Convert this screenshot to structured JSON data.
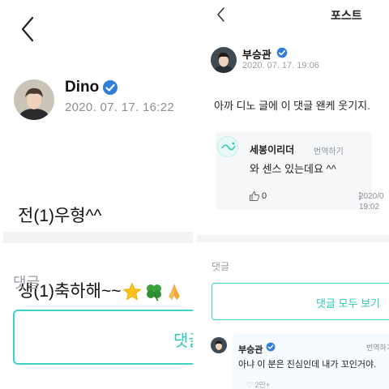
{
  "left": {
    "author": "Dino",
    "timestamp": "2020. 07. 17. 16:22",
    "body_line1": "전(1)우형^^",
    "body_line2": "생(1)축하해~~",
    "comments_header": "댓글",
    "comment_button_label": "댓글"
  },
  "right": {
    "header_title": "포스트",
    "author": "부승관",
    "timestamp": "2020. 07. 17. 19:06",
    "body": "아까 디노 글에 이 댓글 왠케 웃기지.",
    "quoted_comment": {
      "author": "세봉이리더",
      "translate_label": "번역하기",
      "text": "와 센스 있는데요 ^^",
      "like_count": "0",
      "time_line1": "2020/0",
      "time_line2": "19:02"
    },
    "comments_header": "댓글",
    "view_all_comments_label": "댓글 모두 보기",
    "reply": {
      "author": "부승관",
      "translate_label": "번역하기",
      "text": "아냐 이 분은 진심인데 내가 꼬인거야.",
      "likes_text": "♡ 2만+"
    }
  },
  "colors": {
    "accent_teal": "#3cd5c3",
    "verified_blue": "#2f7ed8",
    "timestamp_gray": "#8a8f94",
    "section_band_gray": "#f2f3f5"
  },
  "icons": {
    "back": "chevron-left-icon",
    "verified": "verified-badge-icon",
    "star": "star-emoji-icon",
    "clover": "four-leaf-clover-emoji-icon",
    "pray": "folded-hands-emoji-icon",
    "like": "thumbs-up-icon",
    "more": "vertical-dots-icon"
  }
}
